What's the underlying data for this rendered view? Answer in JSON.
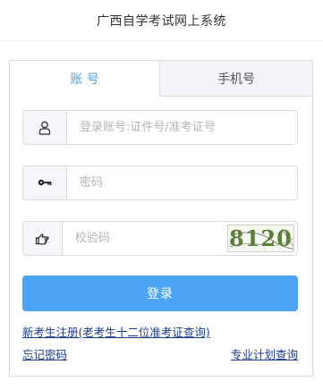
{
  "header": {
    "title": "广西自学考试网上系统"
  },
  "tabs": [
    {
      "label": "账 号",
      "active": true
    },
    {
      "label": "手机号",
      "active": false
    }
  ],
  "form": {
    "account_placeholder": "登录账号:证件号/准考证号",
    "password_placeholder": "密码",
    "captcha_placeholder": "校验码",
    "captcha_text": "8120",
    "login_label": "登录"
  },
  "links": {
    "register": "新考生注册(老考生十二位准考证查询)",
    "forgot_password": "忘记密码",
    "plan_query": "专业计划查询"
  },
  "icons": {
    "account": "user-icon",
    "password": "key-icon",
    "captcha": "pointing-hand-icon"
  },
  "colors": {
    "accent": "#4ea4f4",
    "active_tab_text": "#4aa3f1",
    "link": "#1a3a8e"
  }
}
